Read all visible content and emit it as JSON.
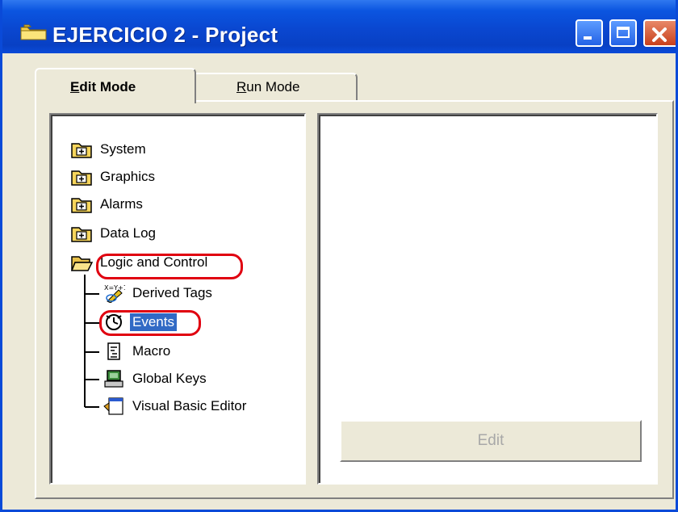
{
  "window": {
    "title": "EJERCICIO 2 - Project",
    "controls": [
      "minimize",
      "maximize",
      "close"
    ]
  },
  "tabs": [
    {
      "label": "Edit Mode",
      "selected": true
    },
    {
      "label": "Run Mode",
      "selected": false
    }
  ],
  "tree": {
    "folders": [
      {
        "label": "System",
        "icon": "folder-plus-icon"
      },
      {
        "label": "Graphics",
        "icon": "folder-plus-icon"
      },
      {
        "label": "Alarms",
        "icon": "folder-plus-icon"
      },
      {
        "label": "Data Log",
        "icon": "folder-plus-icon"
      },
      {
        "label": "Logic and Control",
        "icon": "folder-open-icon"
      }
    ],
    "children": [
      {
        "label": "Derived Tags",
        "icon": "derived-tags-icon"
      },
      {
        "label": "Events",
        "icon": "events-clock-icon",
        "selected": true
      },
      {
        "label": "Macro",
        "icon": "macro-icon"
      },
      {
        "label": "Global Keys",
        "icon": "global-keys-icon"
      },
      {
        "label": "Visual Basic Editor",
        "icon": "vb-editor-icon"
      }
    ]
  },
  "edit_button": {
    "label": "Edit",
    "enabled": false
  },
  "colors": {
    "titlebar": "#0a4ad8",
    "selection": "#316ac5",
    "annotation": "#e00010",
    "face": "#ece9d8"
  }
}
